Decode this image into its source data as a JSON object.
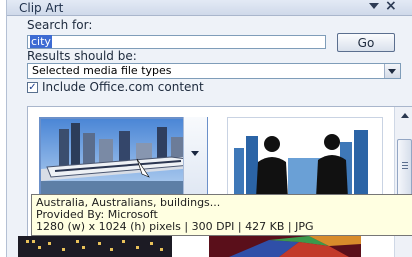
{
  "pane": {
    "title": "Clip Art",
    "menu_icon": "chevron-down-icon",
    "close_icon": "close-icon",
    "close_glyph": "×"
  },
  "search": {
    "label": "Search for:",
    "value": "city",
    "go_label": "Go"
  },
  "results_filter": {
    "label": "Results should be:",
    "selected": "Selected media file types"
  },
  "office_content": {
    "checked": true,
    "check_glyph": "✓",
    "label": "Include Office.com content"
  },
  "results": {
    "items": [
      {
        "icon": "city-train-image"
      },
      {
        "icon": "business-people-image"
      },
      {
        "icon": "city-night-image"
      },
      {
        "icon": "abstract-image"
      }
    ]
  },
  "tooltip": {
    "line1": "Australia, Australians, buildings...",
    "line2": "Provided By: Microsoft",
    "line3": "1280 (w) x 1024 (h) pixels | 300 DPI | 427 KB | JPG"
  },
  "colors": {
    "pane_background": "#eef2f8",
    "selection_border": "#6b90c9",
    "tooltip_background": "#ffffe1"
  }
}
